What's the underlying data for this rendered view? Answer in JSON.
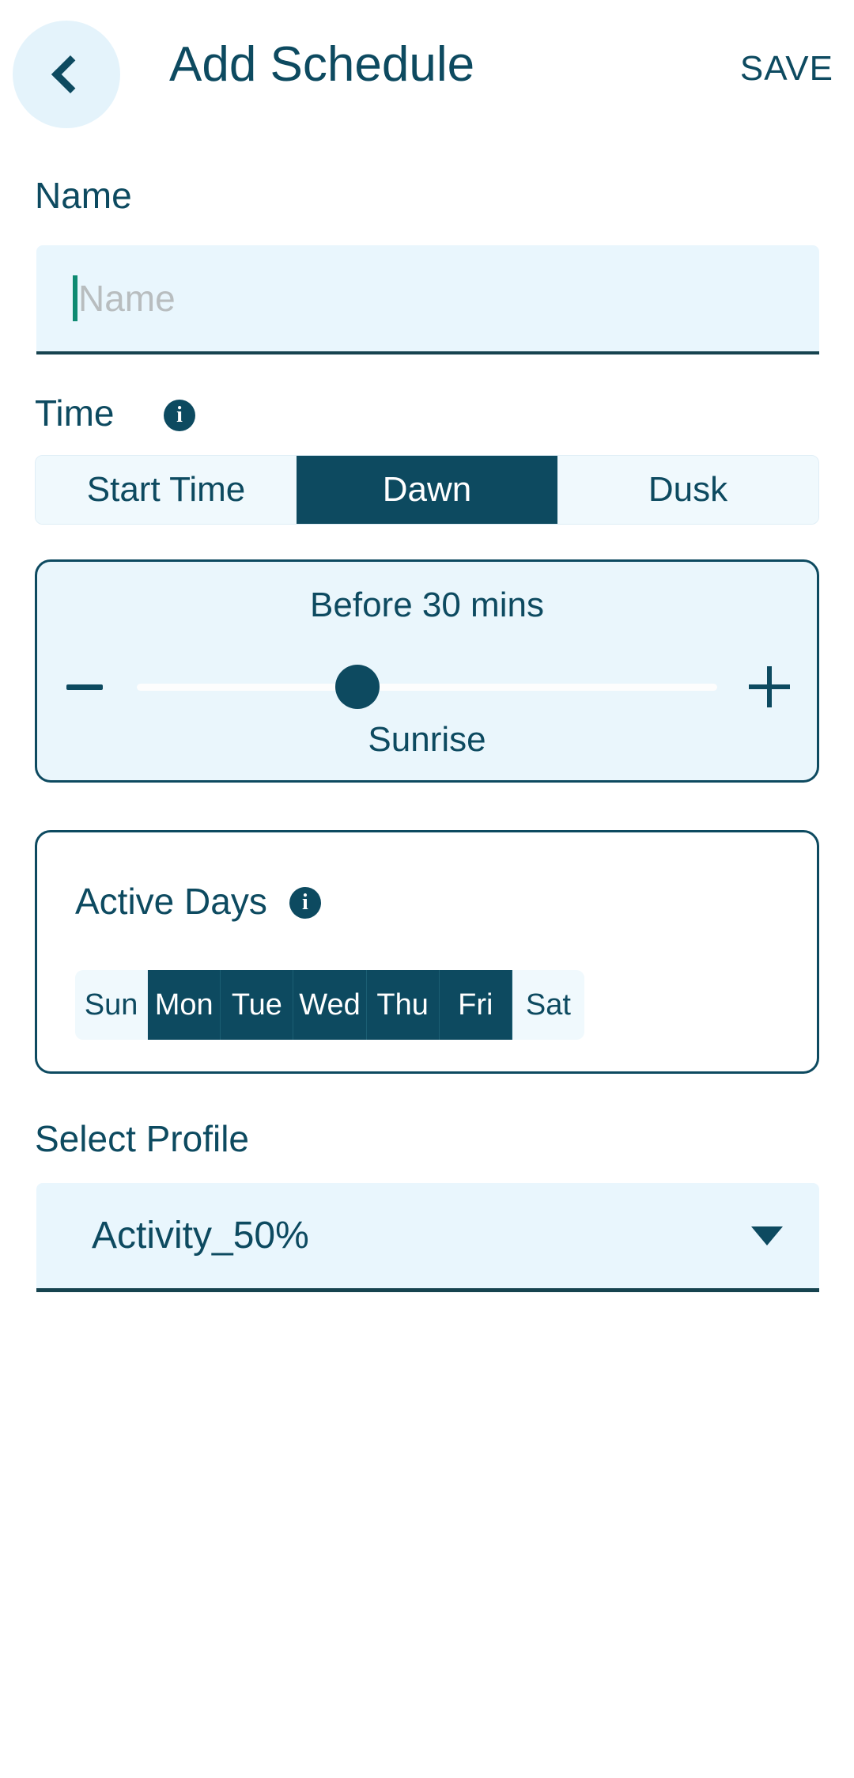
{
  "header": {
    "title": "Add Schedule",
    "save_label": "SAVE",
    "back_icon": "chevron-left-icon"
  },
  "name_section": {
    "label": "Name",
    "placeholder": "Name",
    "value": ""
  },
  "time_section": {
    "label": "Time",
    "info_icon": "info-icon",
    "info_glyph": "i",
    "segments": [
      {
        "label": "Start Time",
        "selected": false
      },
      {
        "label": "Dawn",
        "selected": true
      },
      {
        "label": "Dusk",
        "selected": false
      }
    ],
    "offset": {
      "value_label": "Before 30 mins",
      "reference_label": "Sunrise",
      "minus_label": "−",
      "plus_label": "+",
      "thumb_percent": 38
    }
  },
  "active_days": {
    "title": "Active Days",
    "info_icon": "info-icon",
    "info_glyph": "i",
    "days": [
      {
        "label": "Sun",
        "selected": false
      },
      {
        "label": "Mon",
        "selected": true
      },
      {
        "label": "Tue",
        "selected": true
      },
      {
        "label": "Wed",
        "selected": true
      },
      {
        "label": "Thu",
        "selected": true
      },
      {
        "label": "Fri",
        "selected": true
      },
      {
        "label": "Sat",
        "selected": false
      }
    ]
  },
  "profile_section": {
    "label": "Select Profile",
    "selected": "Activity_50%",
    "dropdown_icon": "chevron-down-icon"
  },
  "colors": {
    "primary_dark": "#0d4a60",
    "light_fill": "#e9f6fd",
    "pale_fill": "#f0f9fd",
    "back_circle": "#e4f3fb",
    "caret": "#0e8a72",
    "placeholder": "#b8bdbf"
  }
}
